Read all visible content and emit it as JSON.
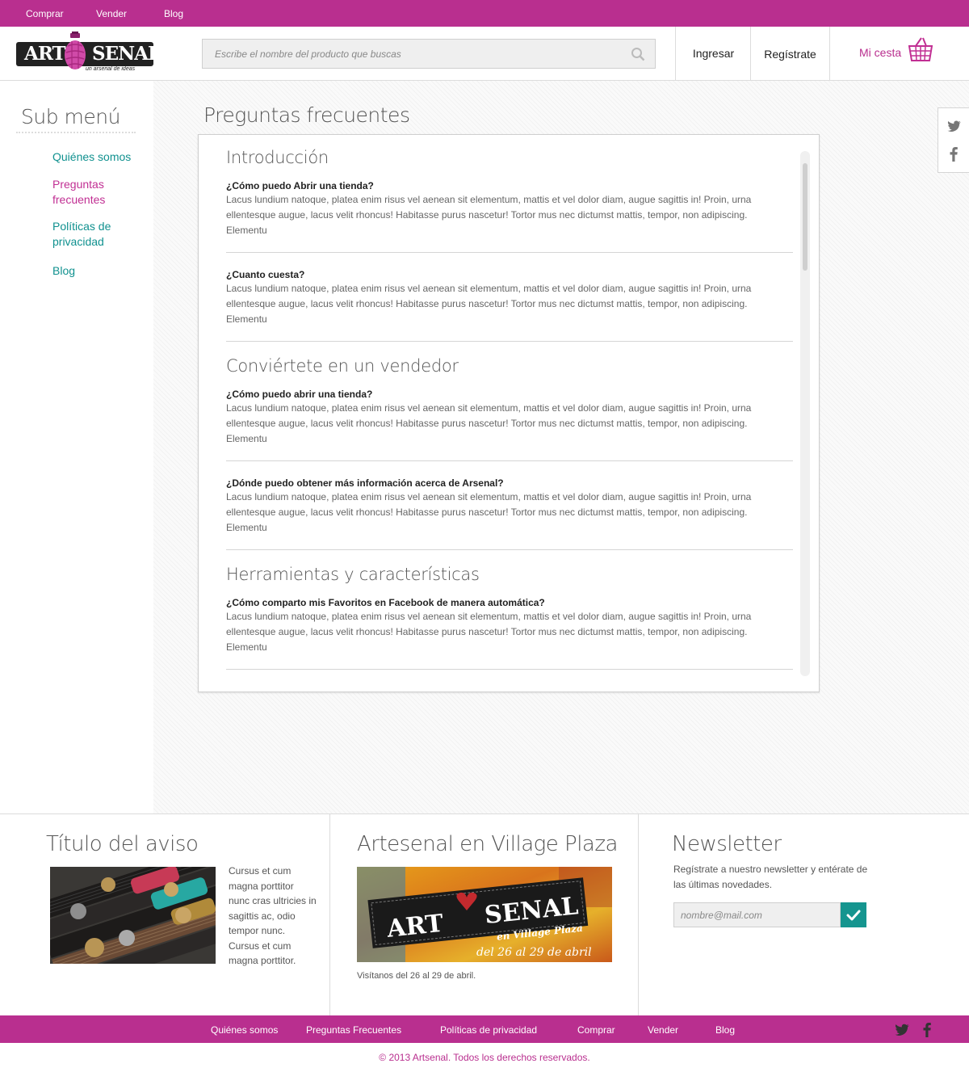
{
  "topnav": [
    "Comprar",
    "Vender",
    "Blog"
  ],
  "brand": {
    "left": "ART",
    "right": "SENAL",
    "tagline": "un arsenal de ideas",
    "accent": "#b92f8f",
    "teal": "#10918f"
  },
  "search": {
    "placeholder": "Escribe el nombre del producto que buscas",
    "value": ""
  },
  "header": {
    "login": "Ingresar",
    "register": "Regístrate",
    "cart": "Mi cesta"
  },
  "sidebar": {
    "title": "Sub menú",
    "items": [
      {
        "label": "Quiénes somos"
      },
      {
        "label": "Preguntas frecuentes",
        "active": true
      },
      {
        "label": "Políticas de privacidad"
      },
      {
        "label": "Blog"
      }
    ]
  },
  "main": {
    "title": "Preguntas frecuentes",
    "sections": [
      {
        "title": "Introducción",
        "questions": [
          {
            "q": "¿Cómo puedo Abrir una tienda?",
            "a": "Lacus lundium natoque, platea enim risus vel aenean sit elementum, mattis et vel dolor diam, augue sagittis in! Proin, urna ellentesque augue, lacus velit rhoncus! Habitasse purus nascetur! Tortor mus nec dictumst mattis, tempor, non adipiscing. Elementu"
          },
          {
            "q": "¿Cuanto cuesta?",
            "a": "Lacus lundium natoque, platea enim risus vel aenean sit elementum, mattis et vel dolor diam, augue sagittis in! Proin, urna ellentesque augue, lacus velit rhoncus! Habitasse purus nascetur! Tortor mus nec dictumst mattis, tempor, non adipiscing. Elementu"
          }
        ]
      },
      {
        "title": "Conviértete en un vendedor",
        "questions": [
          {
            "q": "¿Cómo puedo abrir una tienda?",
            "a": "Lacus lundium natoque, platea enim risus vel aenean sit elementum, mattis et vel dolor diam, augue sagittis in! Proin, urna ellentesque augue, lacus velit rhoncus! Habitasse purus nascetur! Tortor mus nec dictumst mattis, tempor, non adipiscing. Elementu"
          },
          {
            "q": "¿Dónde puedo obtener más información acerca de Arsenal?",
            "a": "Lacus lundium natoque, platea enim risus vel aenean sit elementum, mattis et vel dolor diam, augue sagittis in! Proin, urna ellentesque augue, lacus velit rhoncus! Habitasse purus nascetur! Tortor mus nec dictumst mattis, tempor, non adipiscing. Elementu"
          }
        ]
      },
      {
        "title": "Herramientas y características",
        "questions": [
          {
            "q": "¿Cómo comparto mis Favoritos en Facebook de manera automática?",
            "a": "Lacus lundium natoque, platea enim risus vel aenean sit elementum, mattis et vel dolor diam, augue sagittis in! Proin, urna ellentesque augue, lacus velit rhoncus! Habitasse purus nascetur! Tortor mus nec dictumst mattis, tempor, non adipiscing. Elementu"
          }
        ]
      }
    ]
  },
  "footer": {
    "aviso": {
      "title": "Título del aviso",
      "text": "Cursus et cum magna porttitor nunc cras ultricies in sagittis ac, odio tempor nunc. Cursus et cum magna porttitor."
    },
    "plaza": {
      "title": "Artesenal en Village Plaza",
      "banner_left": "ART",
      "banner_right": "SENAL",
      "banner_sub": "en Village Plaza",
      "banner_dates": "del 26 al 29 de abril",
      "caption": "Visítanos del 26 al 29 de abril."
    },
    "newsletter": {
      "title": "Newsletter",
      "text": "Regístrate a nuestro newsletter y entérate de las últimas novedades.",
      "placeholder": "nombre@mail.com"
    }
  },
  "bottomnav": [
    "Quiénes somos",
    "Preguntas Frecuentes",
    "Políticas de privacidad",
    "Comprar",
    "Vender",
    "Blog"
  ],
  "copyright": "© 2013 Artsenal. Todos los derechos reservados.",
  "icons": [
    "search-icon",
    "basket-icon",
    "twitter-icon",
    "facebook-icon",
    "check-icon",
    "grenade-icon"
  ]
}
